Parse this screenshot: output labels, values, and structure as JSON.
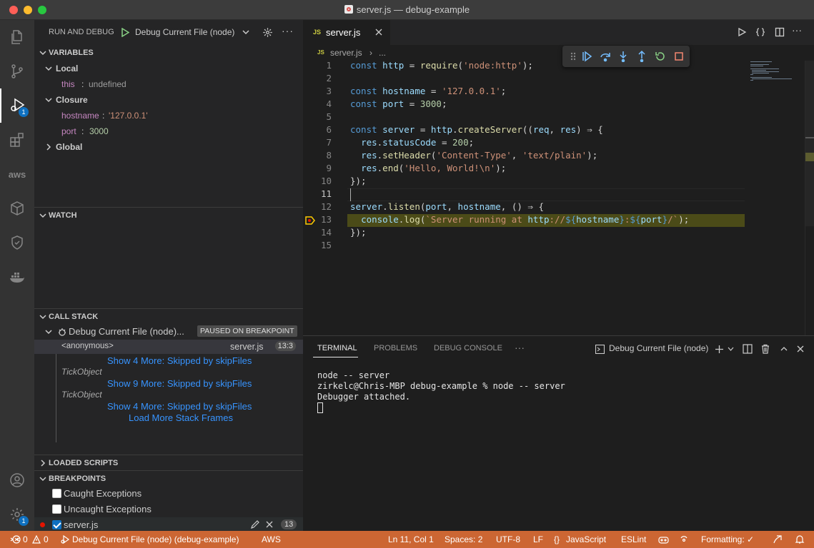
{
  "window": {
    "title": "server.js — debug-example"
  },
  "activity_bar": {
    "items": [
      {
        "name": "explorer-icon"
      },
      {
        "name": "source-control-icon"
      },
      {
        "name": "run-debug-icon",
        "badge": "1"
      },
      {
        "name": "extensions-icon"
      },
      {
        "name": "aws-icon",
        "label": "aws"
      },
      {
        "name": "cube-icon"
      },
      {
        "name": "testing-icon"
      },
      {
        "name": "docker-icon"
      }
    ],
    "bottom": [
      {
        "name": "account-icon"
      },
      {
        "name": "settings-gear-icon",
        "badge": "1"
      }
    ]
  },
  "sidebar": {
    "title": "RUN AND DEBUG",
    "config": "Debug Current File (node)",
    "variables": {
      "header": "VARIABLES",
      "local": {
        "label": "Local",
        "items": [
          {
            "name": "this",
            "value": "undefined"
          }
        ]
      },
      "closure": {
        "label": "Closure",
        "items": [
          {
            "name": "hostname",
            "value": "'127.0.0.1'"
          },
          {
            "name": "port",
            "value": "3000"
          }
        ]
      },
      "global": {
        "label": "Global"
      }
    },
    "watch": {
      "header": "WATCH"
    },
    "call_stack": {
      "header": "CALL STACK",
      "session": "Debug Current File (node)...",
      "status": "PAUSED ON BREAKPOINT",
      "frames": [
        {
          "name": "<anonymous>",
          "file": "server.js",
          "line": "13:3"
        }
      ],
      "skipped1": "Show 4 More: Skipped by skipFiles",
      "tick1": "TickObject",
      "skipped2": "Show 9 More: Skipped by skipFiles",
      "tick2": "TickObject",
      "skipped3": "Show 4 More: Skipped by skipFiles",
      "load_more": "Load More Stack Frames"
    },
    "loaded_scripts": {
      "header": "LOADED SCRIPTS"
    },
    "breakpoints": {
      "header": "BREAKPOINTS",
      "caught": "Caught Exceptions",
      "uncaught": "Uncaught Exceptions",
      "file": "server.js",
      "count": "13"
    }
  },
  "editor": {
    "tab": "server.js",
    "breadcrumb": {
      "file": "server.js",
      "more": "..."
    },
    "lines": [
      "const http = require('node:http');",
      "",
      "const hostname = '127.0.0.1';",
      "const port = 3000;",
      "",
      "const server = http.createServer((req, res) ⇒ {",
      "  res.statusCode = 200;",
      "  res.setHeader('Content-Type', 'text/plain');",
      "  res.end('Hello, World!\\n');",
      "});",
      "",
      "server.listen(port, hostname, () ⇒ {",
      "  console.log(`Server running at http://${hostname}:${port}/`);",
      "});",
      ""
    ],
    "line_numbers": [
      "1",
      "2",
      "3",
      "4",
      "5",
      "6",
      "7",
      "8",
      "9",
      "10",
      "11",
      "12",
      "13",
      "14",
      "15"
    ],
    "current_line": 11,
    "paused_line": 13
  },
  "panel": {
    "tabs": [
      "TERMINAL",
      "PROBLEMS",
      "DEBUG CONSOLE"
    ],
    "more": "···",
    "terminal_name": "Debug Current File (node)",
    "terminal_lines": [
      "node -- server",
      "zirkelc@Chris-MBP debug-example % node -- server",
      "Debugger attached."
    ]
  },
  "statusbar": {
    "errors": "0",
    "warnings": "0",
    "debug": "Debug Current File (node) (debug-example)",
    "aws": "AWS",
    "position": "Ln 11, Col 1",
    "spaces": "Spaces: 2",
    "encoding": "UTF-8",
    "eol": "LF",
    "language": "JavaScript",
    "eslint": "ESLint",
    "formatting": "Formatting: ✓"
  },
  "colors": {
    "statusbar": "#cc6633",
    "accent": "#0e70c0",
    "paused_line": "#4b4b18"
  }
}
